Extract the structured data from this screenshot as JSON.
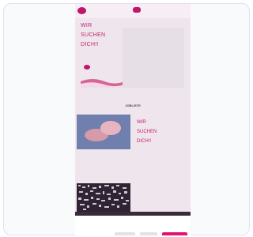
{
  "header": {
    "logo_text": "",
    "nav_label": ""
  },
  "hero": {
    "title_lines": [
      "WIR",
      "SUCHEN",
      "DICH!!"
    ],
    "badge_text": "",
    "box_text": ""
  },
  "jobs": {
    "section_title": "JOBLISTE",
    "right_title_lines": [
      "WIR",
      "SUCHEN",
      "DICH!!"
    ],
    "card_text": ""
  },
  "cookie": {
    "title": "",
    "text": "",
    "necessary_label": "",
    "settings_label": "",
    "accept_label": ""
  }
}
